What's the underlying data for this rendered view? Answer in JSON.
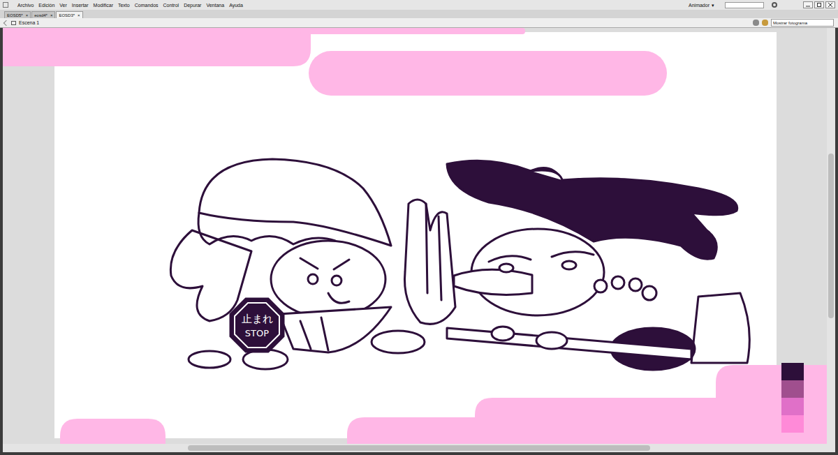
{
  "menubar": {
    "items": [
      "Archivo",
      "Edición",
      "Ver",
      "Insertar",
      "Modificar",
      "Texto",
      "Comandos",
      "Control",
      "Depurar",
      "Ventana",
      "Ayuda"
    ],
    "workspace": "Animador",
    "workspace_arrow": "▾"
  },
  "tabs": [
    {
      "label": "EOSD5*",
      "close": "×",
      "selected": false
    },
    {
      "label": "eosd4*",
      "close": "×",
      "selected": false
    },
    {
      "label": "EOSD3*",
      "close": "×",
      "selected": true
    }
  ],
  "scene_bar": {
    "scene": "Escena 1",
    "view": "Mostrar fotograma"
  },
  "stage": {
    "sign": {
      "lines": [
        "止まれ",
        "STOP"
      ]
    },
    "swatches": [
      {
        "color": "#2d0f3a"
      },
      {
        "color": "#a04f8e"
      },
      {
        "color": "#e070c8"
      },
      {
        "color": "#ff8ad8"
      }
    ]
  }
}
